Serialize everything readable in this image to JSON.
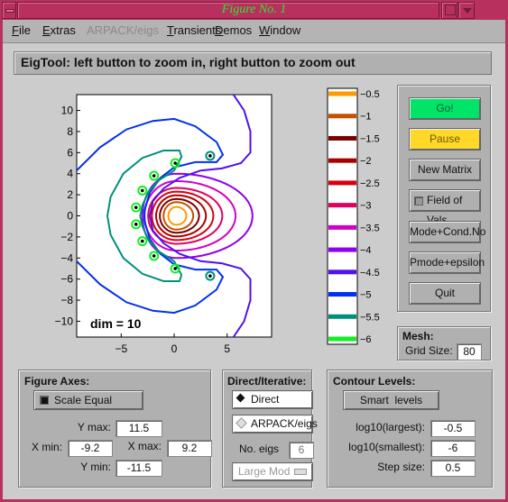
{
  "window": {
    "title": "Figure No. 1"
  },
  "menu": [
    {
      "label": "File",
      "u": "F",
      "rest": "ile",
      "enabled": true
    },
    {
      "label": "Extras",
      "u": "E",
      "rest": "xtras",
      "enabled": true
    },
    {
      "label": "ARPACK/eigs",
      "u": "",
      "rest": "ARPACK/eigs",
      "enabled": false
    },
    {
      "label": "Transients",
      "u": "T",
      "rest": "ransients",
      "enabled": true
    },
    {
      "label": "Demos",
      "u": "D",
      "rest": "emos",
      "enabled": true
    },
    {
      "label": "Window",
      "u": "W",
      "rest": "indow",
      "enabled": true
    }
  ],
  "status": {
    "message": "EigTool: left button to zoom in, right button to zoom out"
  },
  "plot": {
    "annotation": "dim = 10",
    "xlim": [
      -9.2,
      9.2
    ],
    "ylim": [
      -11.5,
      11.5
    ],
    "xticks": [
      "-5",
      "0",
      "5"
    ],
    "yticks": [
      "10",
      "8",
      "6",
      "4",
      "2",
      "0",
      "-2",
      "-4",
      "-6",
      "-8",
      "-10"
    ]
  },
  "colorbar": {
    "levels": [
      {
        "label": "-0.5",
        "color": "#ff9a00"
      },
      {
        "label": "-1",
        "color": "#c85000"
      },
      {
        "label": "-1.5",
        "color": "#7a0000"
      },
      {
        "label": "-2",
        "color": "#aa0000"
      },
      {
        "label": "-2.5",
        "color": "#d80010"
      },
      {
        "label": "-3",
        "color": "#e00060"
      },
      {
        "label": "-3.5",
        "color": "#d000c8"
      },
      {
        "label": "-4",
        "color": "#9000f0"
      },
      {
        "label": "-4.5",
        "color": "#5010f0"
      },
      {
        "label": "-5",
        "color": "#0030f0"
      },
      {
        "label": "-5.5",
        "color": "#00907a"
      },
      {
        "label": "-6",
        "color": "#10f020"
      }
    ]
  },
  "controls": {
    "go": "Go!",
    "pause": "Pause",
    "new_matrix": "New Matrix",
    "field_of_vals": "Field of Vals.",
    "mode_cond": "Mode+Cond.No",
    "pmode_eps": "Pmode+epsilon",
    "quit": "Quit"
  },
  "mesh": {
    "title": "Mesh:",
    "grid_label": "Grid Size:",
    "grid_value": "80"
  },
  "figure_axes": {
    "title": "Figure Axes:",
    "scale_equal": "Scale Equal",
    "scale_equal_checked": true,
    "ymax_label": "Y max:",
    "ymax": "11.5",
    "xmin_label": "X min:",
    "xmin": "-9.2",
    "xmax_label": "X max:",
    "xmax": "9.2",
    "ymin_label": "Y min:",
    "ymin": "-11.5"
  },
  "direct_iterative": {
    "title": "Direct/Iterative:",
    "direct": "Direct",
    "arpack": "ARPACK/eigs",
    "selected": "Direct",
    "no_eigs_label": "No. eigs",
    "no_eigs": "6",
    "large_mod": "Large Mod"
  },
  "contour_levels": {
    "title": "Contour Levels:",
    "smart_levels": "Smart  levels",
    "largest_label": "log10(largest):",
    "largest": "-0.5",
    "smallest_label": "log10(smallest):",
    "smallest": "-6",
    "step_label": "Step size:",
    "step": "0.5"
  },
  "chart_data": {
    "type": "contour",
    "title": "",
    "annotation": "dim = 10",
    "xlim": [
      -9.2,
      9.2
    ],
    "ylim": [
      -11.5,
      11.5
    ],
    "xticks": [
      -5,
      0,
      5
    ],
    "yticks": [
      -10,
      -8,
      -6,
      -4,
      -2,
      0,
      2,
      4,
      6,
      8,
      10
    ],
    "levels": [
      -0.5,
      -1,
      -1.5,
      -2,
      -2.5,
      -3,
      -3.5,
      -4,
      -4.5,
      -5,
      -5.5,
      -6
    ],
    "eigenvalues": [
      {
        "x": 3.4,
        "y": 5.7
      },
      {
        "x": 0.1,
        "y": 5.0
      },
      {
        "x": -1.9,
        "y": 3.8
      },
      {
        "x": -3.0,
        "y": 2.4
      },
      {
        "x": -3.6,
        "y": 0.8
      },
      {
        "x": -3.6,
        "y": -0.8
      },
      {
        "x": -3.0,
        "y": -2.4
      },
      {
        "x": -1.9,
        "y": -3.8
      },
      {
        "x": 0.1,
        "y": -5.0
      },
      {
        "x": 3.4,
        "y": -5.7
      }
    ]
  }
}
